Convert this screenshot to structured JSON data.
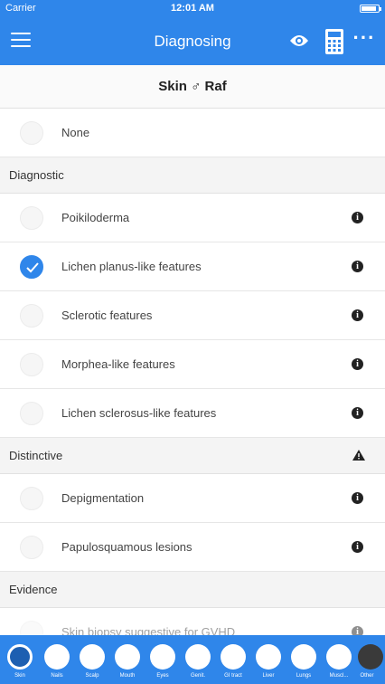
{
  "status_bar": {
    "carrier": "Carrier",
    "time": "12:01 AM"
  },
  "nav": {
    "title": "Diagnosing"
  },
  "sub_header": {
    "title": "Skin ♂ Raf"
  },
  "none_option": {
    "label": "None"
  },
  "sections": [
    {
      "title": "Diagnostic",
      "items": [
        {
          "label": "Poikiloderma",
          "checked": false
        },
        {
          "label": "Lichen planus-like features",
          "checked": true
        },
        {
          "label": "Sclerotic features",
          "checked": false
        },
        {
          "label": "Morphea-like features",
          "checked": false
        },
        {
          "label": "Lichen sclerosus-like features",
          "checked": false
        }
      ]
    },
    {
      "title": "Distinctive",
      "items": [
        {
          "label": "Depigmentation",
          "checked": false
        },
        {
          "label": "Papulosquamous lesions",
          "checked": false
        }
      ]
    },
    {
      "title": "Evidence",
      "items": [
        {
          "label": "Skin biopsy suggestive for GVHD",
          "checked": false
        }
      ]
    }
  ],
  "bottom_tabs": [
    "Skin",
    "Nails",
    "Scalp",
    "Mouth",
    "Eyes",
    "Genit.",
    "GI tract",
    "Liver",
    "Lungs",
    "Muscl...",
    "Other"
  ],
  "colors": {
    "accent": "#2f86ea"
  }
}
